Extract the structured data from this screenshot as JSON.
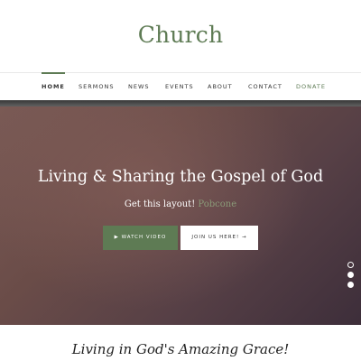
{
  "brand": {
    "name": "Church",
    "accent": "#5e7b54"
  },
  "nav": {
    "items": [
      {
        "label": "HOME",
        "active": true
      },
      {
        "label": "SERMONS"
      },
      {
        "label": "NEWS"
      },
      {
        "label": "EVENTS"
      },
      {
        "label": "ABOUT"
      },
      {
        "label": "CONTACT"
      },
      {
        "label": "DONATE"
      }
    ]
  },
  "hero": {
    "title": "Living & Sharing the Gospel of God",
    "subtitle_prefix": "Get this layout!",
    "subtitle_link": "Pobcone",
    "watch_label": "▶  WATCH VIDEO",
    "join_label": "JOIN US HERE! →",
    "slides": {
      "count": 3,
      "active": 1
    }
  },
  "tagline": "Living in God's Amazing Grace!"
}
